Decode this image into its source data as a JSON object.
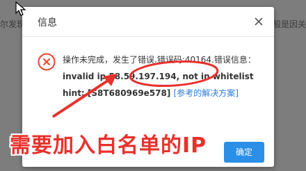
{
  "background": {
    "left_text": "尔发现公",
    "right_text": "般是因关"
  },
  "dialog": {
    "title": "信息",
    "message_prefix": "操作未完成，发生了错误.错误码:40164.错误信息：",
    "message_body": "invalid ip 58.59.197.194, not in whitelist hint: [S8T680969e578]",
    "link_text": "[参考的解决方案]",
    "confirm_label": "确定"
  },
  "annotation": {
    "text": "需要加入白名单的IP",
    "color": "#e8312c"
  },
  "colors": {
    "error_icon": "#e8452c",
    "confirm_button": "#2b8fe8",
    "link": "#2b7bd6"
  }
}
